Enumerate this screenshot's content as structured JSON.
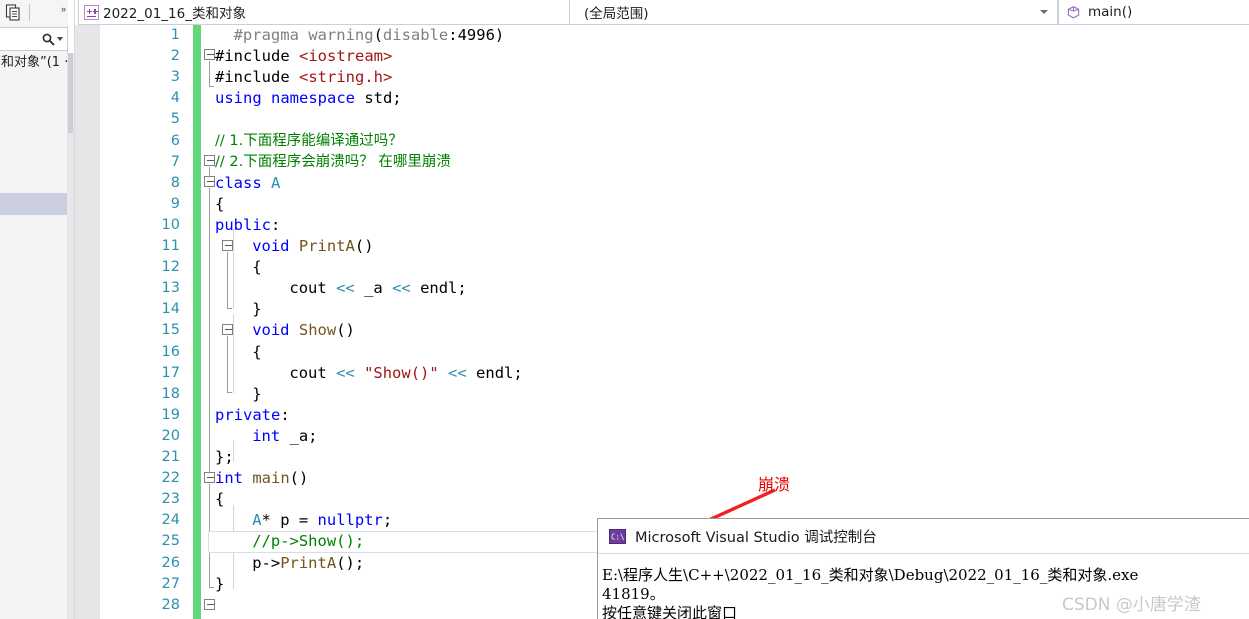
{
  "left_panel": {
    "doc_icon_name": "copy-document-icon",
    "chevrons": "»",
    "search_icon_name": "search-icon",
    "tree_text": "和对象”(1 ·",
    "tree_rows": [
      "和对象”(1 ·"
    ]
  },
  "tabs": {
    "active_tab_label": "2022_01_16_类和对象",
    "project_icon_name": "cpp-project-icon",
    "tab_caret_name": "chevron-down-icon"
  },
  "navbar": {
    "scope": "(全局范围)",
    "scope_caret_name": "chevron-down-icon",
    "member": "main()",
    "member_icon_name": "method-cube-icon"
  },
  "editor": {
    "change_bar_color": "#63d67a",
    "line_number_color": "#2b91af",
    "current_line": 25,
    "lines": [
      {
        "n": 1,
        "tokens": [
          {
            "t": "#pragma warning",
            "c": "t-gray"
          },
          {
            "t": "(",
            "c": "t-black"
          },
          {
            "t": "disable",
            "c": "t-gray"
          },
          {
            "t": ":",
            "c": "t-black"
          },
          {
            "t": "4996",
            "c": "t-num"
          },
          {
            "t": ")",
            "c": "t-black"
          }
        ],
        "indent": 2
      },
      {
        "n": 2,
        "tokens": [
          {
            "t": "#include ",
            "c": "t-black"
          },
          {
            "t": "<iostream>",
            "c": "t-dkred"
          }
        ],
        "indent": 0
      },
      {
        "n": 3,
        "tokens": [
          {
            "t": "#include ",
            "c": "t-black"
          },
          {
            "t": "<string.h>",
            "c": "t-dkred"
          }
        ],
        "indent": 0
      },
      {
        "n": 4,
        "tokens": [
          {
            "t": "using namespace ",
            "c": "t-blue"
          },
          {
            "t": "std;",
            "c": "t-black"
          }
        ],
        "indent": 0
      },
      {
        "n": 5,
        "tokens": [],
        "indent": 0
      },
      {
        "n": 6,
        "tokens": [
          {
            "t": "// 1.下面程序能编译通过吗？",
            "c": "t-green"
          }
        ],
        "indent": 0,
        "cjk": true
      },
      {
        "n": 7,
        "tokens": [
          {
            "t": "// 2.下面程序会崩溃吗？ 在哪里崩溃",
            "c": "t-green"
          }
        ],
        "indent": 0,
        "cjk": true
      },
      {
        "n": 8,
        "tokens": [
          {
            "t": "class ",
            "c": "t-blue"
          },
          {
            "t": "A",
            "c": "t-teal"
          }
        ],
        "indent": 0
      },
      {
        "n": 9,
        "tokens": [
          {
            "t": "{",
            "c": "t-black"
          }
        ],
        "indent": 0
      },
      {
        "n": 10,
        "tokens": [
          {
            "t": "public",
            "c": "t-blue"
          },
          {
            "t": ":",
            "c": "t-black"
          }
        ],
        "indent": 0
      },
      {
        "n": 11,
        "tokens": [
          {
            "t": "void ",
            "c": "t-blue"
          },
          {
            "t": "PrintA",
            "c": "t-func"
          },
          {
            "t": "()",
            "c": "t-black"
          }
        ],
        "indent": 4
      },
      {
        "n": 12,
        "tokens": [
          {
            "t": "{",
            "c": "t-black"
          }
        ],
        "indent": 4
      },
      {
        "n": 13,
        "tokens": [
          {
            "t": "cout ",
            "c": "t-black"
          },
          {
            "t": "<< ",
            "c": "t-cyan"
          },
          {
            "t": "_a ",
            "c": "t-black"
          },
          {
            "t": "<< ",
            "c": "t-cyan"
          },
          {
            "t": "endl;",
            "c": "t-black"
          }
        ],
        "indent": 8
      },
      {
        "n": 14,
        "tokens": [
          {
            "t": "}",
            "c": "t-black"
          }
        ],
        "indent": 4
      },
      {
        "n": 15,
        "tokens": [
          {
            "t": "void ",
            "c": "t-blue"
          },
          {
            "t": "Show",
            "c": "t-func"
          },
          {
            "t": "()",
            "c": "t-black"
          }
        ],
        "indent": 4
      },
      {
        "n": 16,
        "tokens": [
          {
            "t": "{",
            "c": "t-black"
          }
        ],
        "indent": 4
      },
      {
        "n": 17,
        "tokens": [
          {
            "t": "cout ",
            "c": "t-black"
          },
          {
            "t": "<< ",
            "c": "t-cyan"
          },
          {
            "t": "\"Show()\"",
            "c": "t-dkred"
          },
          {
            "t": " << ",
            "c": "t-cyan"
          },
          {
            "t": "endl;",
            "c": "t-black"
          }
        ],
        "indent": 8
      },
      {
        "n": 18,
        "tokens": [
          {
            "t": "}",
            "c": "t-black"
          }
        ],
        "indent": 4
      },
      {
        "n": 19,
        "tokens": [
          {
            "t": "private",
            "c": "t-blue"
          },
          {
            "t": ":",
            "c": "t-black"
          }
        ],
        "indent": 0
      },
      {
        "n": 20,
        "tokens": [
          {
            "t": "int ",
            "c": "t-blue"
          },
          {
            "t": "_a;",
            "c": "t-black"
          }
        ],
        "indent": 4
      },
      {
        "n": 21,
        "tokens": [
          {
            "t": "};",
            "c": "t-black"
          }
        ],
        "indent": 0
      },
      {
        "n": 22,
        "tokens": [
          {
            "t": "int ",
            "c": "t-blue"
          },
          {
            "t": "main",
            "c": "t-func"
          },
          {
            "t": "()",
            "c": "t-black"
          }
        ],
        "indent": 0
      },
      {
        "n": 23,
        "tokens": [
          {
            "t": "{",
            "c": "t-black"
          }
        ],
        "indent": 0
      },
      {
        "n": 24,
        "tokens": [
          {
            "t": "A",
            "c": "t-teal"
          },
          {
            "t": "* p = ",
            "c": "t-black"
          },
          {
            "t": "nullptr",
            "c": "t-blue"
          },
          {
            "t": ";",
            "c": "t-black"
          }
        ],
        "indent": 4
      },
      {
        "n": 25,
        "tokens": [
          {
            "t": "//p->Show();",
            "c": "t-green"
          }
        ],
        "indent": 4
      },
      {
        "n": 26,
        "tokens": [
          {
            "t": "p->",
            "c": "t-black"
          },
          {
            "t": "PrintA",
            "c": "t-func"
          },
          {
            "t": "();",
            "c": "t-black"
          }
        ],
        "indent": 4
      },
      {
        "n": 27,
        "tokens": [
          {
            "t": "}",
            "c": "t-black"
          }
        ],
        "indent": 0
      },
      {
        "n": 28,
        "tokens": [],
        "indent": 0
      }
    ]
  },
  "annotation": {
    "label": "崩溃",
    "color": "#e60000",
    "arrow_name": "red-arrow-pointer"
  },
  "console": {
    "icon_name": "console-app-icon",
    "title": "Microsoft Visual Studio 调试控制台",
    "lines": [
      "E:\\程序人生\\C++\\2022_01_16_类和对象\\Debug\\2022_01_16_类和对象.exe",
      "41819。",
      "按任意键关闭此窗口"
    ]
  },
  "watermark": "CSDN @小唐学渣"
}
